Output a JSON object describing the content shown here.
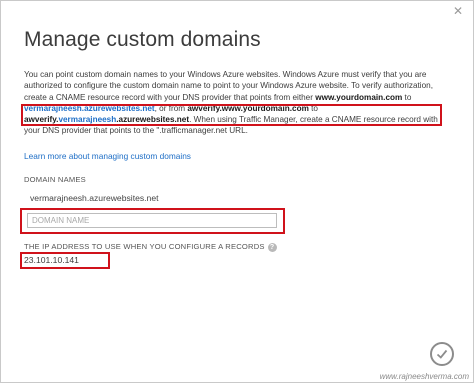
{
  "dialog": {
    "title": "Manage custom domains",
    "description": {
      "p1": "You can point custom domain names to your Windows Azure websites. Windows Azure must verify that you are authorized to configure the custom domain name to point to your Windows Azure website. To verify authorization, create a CNAME resource record with your DNS provider that points from either ",
      "domain1": "www.yourdomain.com",
      "to1": " to ",
      "target1": "vermarajneesh.azurewebsites.net",
      "or": ", or from ",
      "domain2": "awverify.www.yourdomain.com",
      "to2": " to ",
      "target2_prefix": "awverify.",
      "target2_link": "vermarajneesh",
      "target2_suffix": ".azurewebsites.net",
      "p2": ". When using Traffic Manager, create a CNAME resource record with your DNS provider that points to the \".trafficmanager.net URL."
    },
    "learn_link": "Learn more about managing custom domains",
    "domain_names_label": "DOMAIN NAMES",
    "existing_domain": "vermarajneesh.azurewebsites.net",
    "domain_input_placeholder": "DOMAIN NAME",
    "ip_label": "THE IP ADDRESS TO USE WHEN YOU CONFIGURE A RECORDS",
    "ip_value": "23.101.10.141"
  },
  "icons": {
    "close": "close-icon",
    "help": "help-icon",
    "ok": "checkmark-icon"
  },
  "colors": {
    "highlight": "#d0121b",
    "link": "#1e6ec6"
  },
  "watermark": "www.rajneeshverma.com"
}
